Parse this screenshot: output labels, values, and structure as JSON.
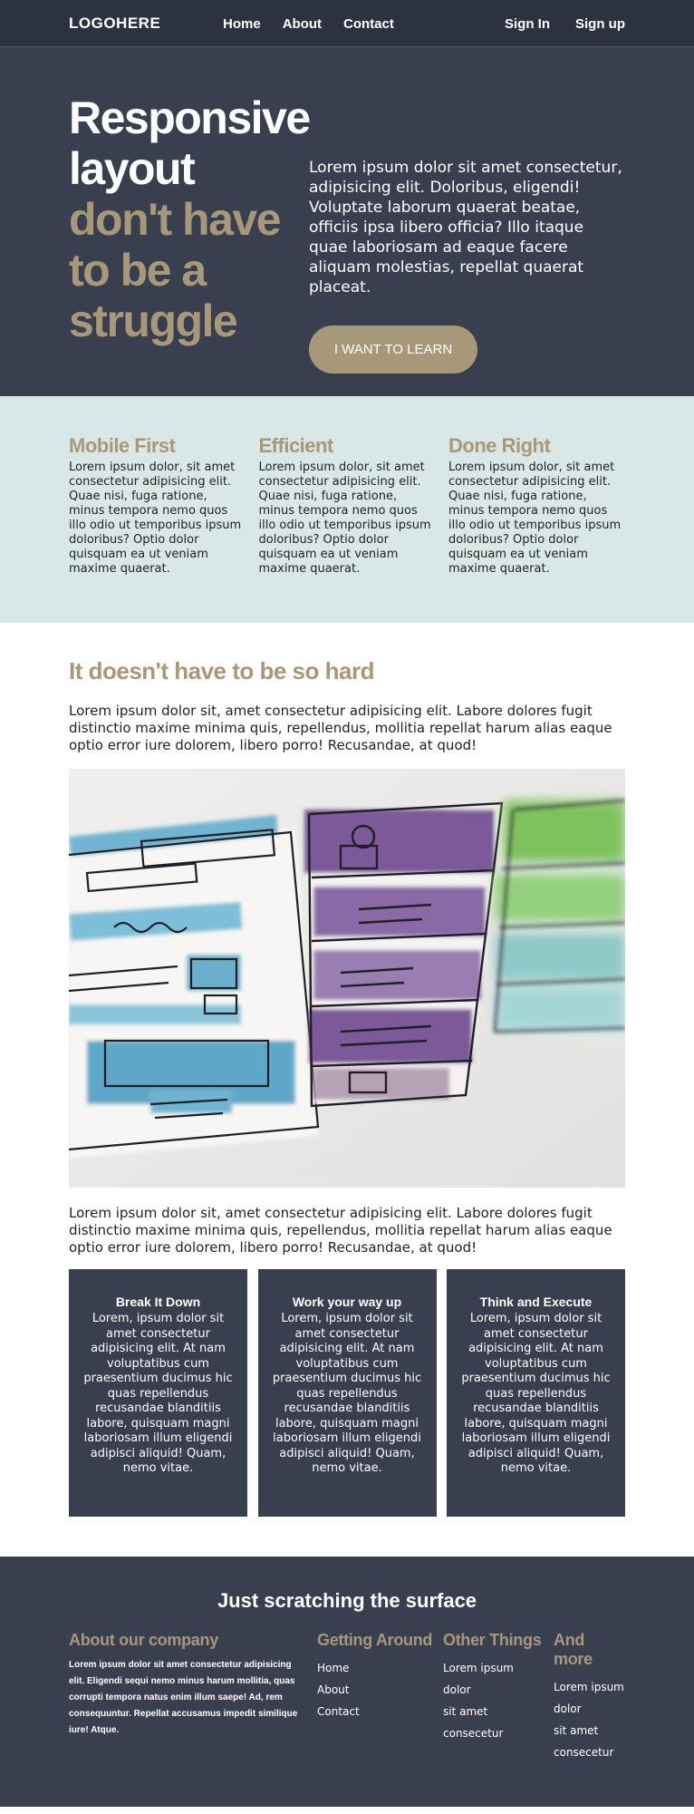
{
  "header": {
    "logo": "LOGOHERE",
    "nav": [
      "Home",
      "About",
      "Contact"
    ],
    "auth": [
      "Sign In",
      "Sign up"
    ]
  },
  "hero": {
    "title_line1": "Responsive",
    "title_line2": "layout",
    "title_line3": "don't have",
    "title_line4": "to be a",
    "title_line5": "struggle",
    "text": "Lorem ipsum dolor sit amet consectetur, adipisicing elit. Doloribus, eligendi! Voluptate laborum quaerat beatae, officiis ipsa libero officia? Illo itaque quae laboriosam ad eaque facere aliquam molestias, repellat quaerat placeat.",
    "button": "I WANT TO LEARN"
  },
  "features": [
    {
      "title": "Mobile First",
      "text": "Lorem ipsum dolor, sit amet consectetur adipisicing elit. Quae nisi, fuga ratione, minus tempora nemo quos illo odio ut temporibus ipsum doloribus? Optio dolor quisquam ea ut veniam maxime quaerat."
    },
    {
      "title": "Efficient",
      "text": "Lorem ipsum dolor, sit amet consectetur adipisicing elit. Quae nisi, fuga ratione, minus tempora nemo quos illo odio ut temporibus ipsum doloribus? Optio dolor quisquam ea ut veniam maxime quaerat."
    },
    {
      "title": "Done Right",
      "text": "Lorem ipsum dolor, sit amet consectetur adipisicing elit. Quae nisi, fuga ratione, minus tempora nemo quos illo odio ut temporibus ipsum doloribus? Optio dolor quisquam ea ut veniam maxime quaerat."
    }
  ],
  "article": {
    "title": "It doesn't have to be so hard",
    "para1": "Lorem ipsum dolor sit, amet consectetur adipisicing elit. Labore dolores fugit distinctio maxime minima quis, repellendus, mollitia repellat harum alias eaque optio error iure dolorem, libero porro! Recusandae, at quod!",
    "para2": "Lorem ipsum dolor sit, amet consectetur adipisicing elit. Labore dolores fugit distinctio maxime minima quis, repellendus, mollitia repellat harum alias eaque optio error iure dolorem, libero porro! Recusandae, at quod!",
    "cards": [
      {
        "title": "Break It Down",
        "text": "Lorem, ipsum dolor sit amet consectetur adipisicing elit. At nam voluptatibus cum praesentium ducimus hic quas repellendus recusandae blanditiis labore, quisquam magni laboriosam illum eligendi adipisci aliquid! Quam, nemo vitae."
      },
      {
        "title": "Work your way up",
        "text": "Lorem, ipsum dolor sit amet consectetur adipisicing elit. At nam voluptatibus cum praesentium ducimus hic quas repellendus recusandae blanditiis labore, quisquam magni laboriosam illum eligendi adipisci aliquid! Quam, nemo vitae."
      },
      {
        "title": "Think and Execute",
        "text": "Lorem, ipsum dolor sit amet consectetur adipisicing elit. At nam voluptatibus cum praesentium ducimus hic quas repellendus recusandae blanditiis labore, quisquam magni laboriosam illum eligendi adipisci aliquid! Quam, nemo vitae."
      }
    ]
  },
  "footer": {
    "title": "Just scratching the surface",
    "about_title": "About our company",
    "about_text": "Lorem ipsum dolor sit amet consectetur adipisicing elit. Eligendi sequi nemo minus harum mollitia, quas corrupti tempora natus enim illum saepe! Ad, rem consequuntur. Repellat accusamus impedit similique iure! Atque.",
    "getting_around_title": "Getting Around",
    "getting_around_links": [
      "Home",
      "About",
      "Contact"
    ],
    "other_title": "Other Things",
    "other_items": [
      "Lorem ipsum",
      "dolor",
      "sit amet",
      "consecetur"
    ],
    "more_title": "And more",
    "more_items": [
      "Lorem ipsum",
      "dolor",
      "sit amet",
      "consecetur"
    ]
  },
  "colors": {
    "dark": "#3a3f4f",
    "header": "#2d3240",
    "gold": "#a8987a",
    "mint": "#d9e8e7"
  }
}
